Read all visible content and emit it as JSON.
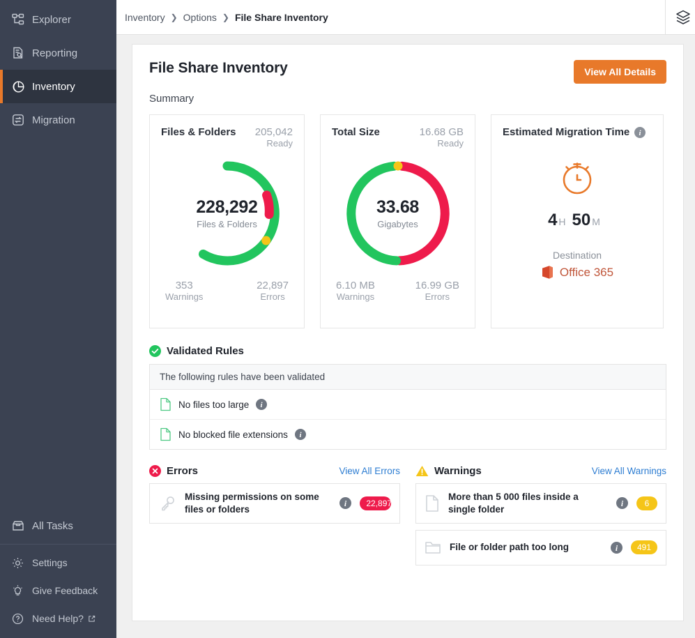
{
  "sidebar": {
    "top_items": [
      {
        "label": "Explorer",
        "icon": "explorer-tree-icon",
        "active": false
      },
      {
        "label": "Reporting",
        "icon": "report-document-icon",
        "active": false
      },
      {
        "label": "Inventory",
        "icon": "pie-chart-icon",
        "active": true
      },
      {
        "label": "Migration",
        "icon": "transfer-arrows-icon",
        "active": false
      }
    ],
    "tasks_item": {
      "label": "All Tasks",
      "icon": "inbox-icon"
    },
    "bottom_items": [
      {
        "label": "Settings",
        "icon": "gear-icon",
        "external": false
      },
      {
        "label": "Give Feedback",
        "icon": "lightbulb-icon",
        "external": false
      },
      {
        "label": "Need Help?",
        "icon": "question-circle-icon",
        "external": true
      }
    ],
    "accent_color": "#e8792a",
    "background_color": "#3b4252"
  },
  "topbar": {
    "breadcrumb": [
      "Inventory",
      "Options",
      "File Share Inventory"
    ],
    "separator": "❯",
    "layers_icon": "layers-icon"
  },
  "page": {
    "title": "File Share Inventory",
    "view_all_details_label": "View All Details",
    "summary_label": "Summary"
  },
  "cards": {
    "files_folders": {
      "title": "Files & Folders",
      "kpi_value": "205,042",
      "kpi_label": "Ready",
      "center_value": "228,292",
      "center_label": "Files & Folders",
      "foot_left_value": "353",
      "foot_left_label": "Warnings",
      "foot_right_value": "22,897",
      "foot_right_label": "Errors"
    },
    "total_size": {
      "title": "Total Size",
      "kpi_value": "16.68 GB",
      "kpi_label": "Ready",
      "center_value": "33.68",
      "center_label": "Gigabytes",
      "foot_left_value": "6.10 MB",
      "foot_left_label": "Warnings",
      "foot_right_value": "16.99 GB",
      "foot_right_label": "Errors"
    },
    "migration_time": {
      "title": "Estimated Migration Time",
      "info_icon": "info-icon",
      "timer_icon": "stopwatch-icon",
      "hours": "4",
      "hours_unit": "H",
      "minutes": "50",
      "minutes_unit": "M",
      "destination_label": "Destination",
      "destination_value": "Office 365",
      "destination_icon": "office365-icon"
    }
  },
  "validated_rules": {
    "icon": "check-circle-icon",
    "title": "Validated Rules",
    "header": "The following rules have been validated",
    "items": [
      {
        "label": "No files too large",
        "icon": "file-icon",
        "info_icon": "info-icon"
      },
      {
        "label": "No blocked file extensions",
        "icon": "file-icon",
        "info_icon": "info-icon"
      }
    ]
  },
  "errors": {
    "icon": "error-circle-icon",
    "title": "Errors",
    "link": "View All Errors",
    "items": [
      {
        "label": "Missing permissions on some files or folders",
        "icon": "key-icon",
        "info_icon": "info-icon",
        "count": "22,897"
      }
    ]
  },
  "warnings": {
    "icon": "warning-triangle-icon",
    "title": "Warnings",
    "link": "View All Warnings",
    "items": [
      {
        "label": "More than 5 000 files inside a single folder",
        "icon": "file-icon",
        "info_icon": "info-icon",
        "count": "6"
      },
      {
        "label": "File or folder path too long",
        "icon": "folder-icon",
        "info_icon": "info-icon",
        "count": "491"
      }
    ]
  },
  "chart_data": [
    {
      "type": "pie",
      "title": "Files & Folders",
      "center_value": "228,292",
      "unit": "items",
      "legend_position": "around",
      "slices": [
        {
          "name": "Ready",
          "value": 205042,
          "color": "#22c55e"
        },
        {
          "name": "Errors",
          "value": 22897,
          "color": "#ee1b4b"
        },
        {
          "name": "Warnings",
          "value": 353,
          "color": "#f5c518"
        }
      ]
    },
    {
      "type": "pie",
      "title": "Total Size",
      "center_value": "33.68",
      "unit": "GB",
      "legend_position": "around",
      "slices": [
        {
          "name": "Ready",
          "value": 16.68,
          "color": "#22c55e"
        },
        {
          "name": "Errors",
          "value": 16.99,
          "color": "#ee1b4b"
        },
        {
          "name": "Warnings",
          "value": 0.0061,
          "color": "#f5c518"
        }
      ]
    }
  ],
  "colors": {
    "green": "#22c55e",
    "red": "#ee1b4b",
    "yellow": "#f5c518",
    "orange": "#e8792a",
    "link_blue": "#2d7dd2"
  }
}
